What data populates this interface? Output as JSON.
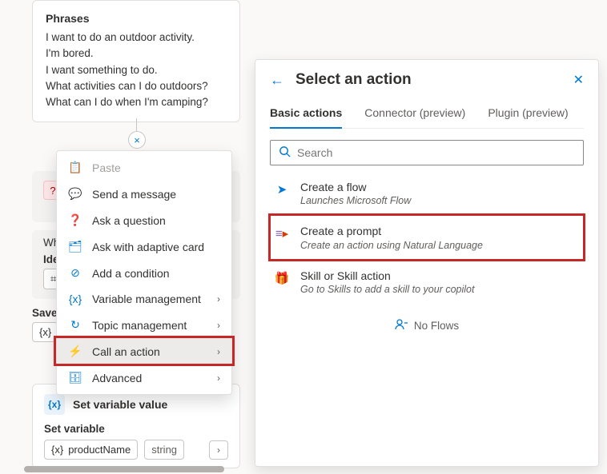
{
  "phrases": {
    "title": "Phrases",
    "lines": [
      "I want to do an outdoor activity.",
      "I'm bored.",
      "I want something to do.",
      "What activities can I do outdoors?",
      "What can I do when I'm camping?"
    ]
  },
  "close_bubble_glyph": "×",
  "question_card": {
    "wh_prefix": "Wh",
    "iden_label": "Iden",
    "chip_icon": "⌗"
  },
  "save_block": {
    "label": "Save",
    "var_icon": "{x}"
  },
  "context_menu": {
    "items": [
      {
        "icon": "📋",
        "label": "Paste",
        "disabled": true,
        "submenu": false
      },
      {
        "icon": "💬",
        "label": "Send a message",
        "disabled": false,
        "submenu": false
      },
      {
        "icon": "❓",
        "label": "Ask a question",
        "disabled": false,
        "submenu": false
      },
      {
        "icon": "🗂",
        "label": "Ask with adaptive card",
        "disabled": false,
        "submenu": false
      },
      {
        "icon": "⊕",
        "label": "Add a condition",
        "disabled": false,
        "submenu": false
      },
      {
        "icon": "{x}",
        "label": "Variable management",
        "disabled": false,
        "submenu": true
      },
      {
        "icon": "⟳",
        "label": "Topic management",
        "disabled": false,
        "submenu": true
      },
      {
        "icon": "⚡",
        "label": "Call an action",
        "disabled": false,
        "submenu": true,
        "selected": true
      },
      {
        "icon": "🗄",
        "label": "Advanced",
        "disabled": false,
        "submenu": true
      }
    ]
  },
  "setvar_card": {
    "title": "Set variable value",
    "icon_text": "{x}",
    "sub_label": "Set variable",
    "var_name": "productName",
    "var_type": "string",
    "arrow": "›"
  },
  "right_panel": {
    "title": "Select an action",
    "back_glyph": "←",
    "close_glyph": "✕",
    "tabs": [
      {
        "label": "Basic actions",
        "active": true
      },
      {
        "label": "Connector (preview)",
        "active": false
      },
      {
        "label": "Plugin (preview)",
        "active": false
      }
    ],
    "search_placeholder": "Search",
    "items": [
      {
        "icon": "➤",
        "title": "Create a flow",
        "desc": "Launches Microsoft Flow",
        "highlight": false
      },
      {
        "icon": "≡►",
        "title": "Create a prompt",
        "desc": "Create an action using Natural Language",
        "highlight": true
      },
      {
        "icon": "🎁",
        "title": "Skill or Skill action",
        "desc": "Go to Skills to add a skill to your copilot",
        "highlight": false
      }
    ],
    "empty_text": "No Flows",
    "empty_icon": "👤"
  }
}
